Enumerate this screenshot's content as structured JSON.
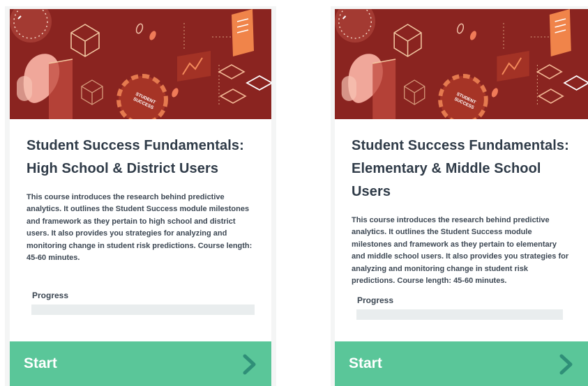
{
  "courses": [
    {
      "title": "Student Success Fundamentals: High School & District Users",
      "description": "This course introduces the research behind predictive analytics. It outlines the Student Success module milestones and framework as they pertain to high school and district users. It also provides you strategies for analyzing and monitoring change in student risk predictions. Course length: 45-60 minutes.",
      "progress_label": "Progress",
      "progress_fraction": 0,
      "start_label": "Start",
      "hero_text": "STUDENT SUCCESS"
    },
    {
      "title": "Student Success Fundamentals: Elementary & Middle School Users",
      "description": "This course introduces the research behind predictive analytics. It outlines the Student Success module milestones and framework as they pertain to elementary and middle school users. It also provides you strategies for analyzing and monitoring change in student risk predictions. Course length: 45-60 minutes.",
      "progress_label": "Progress",
      "progress_fraction": 0,
      "start_label": "Start",
      "hero_text": "STUDENT SUCCESS"
    }
  ],
  "colors": {
    "hero_bg": "#8a2420",
    "accent": "#5ac699",
    "title": "#2f3b48",
    "progress_track": "#e9edee"
  },
  "icons": [
    "chevron-right-icon"
  ]
}
